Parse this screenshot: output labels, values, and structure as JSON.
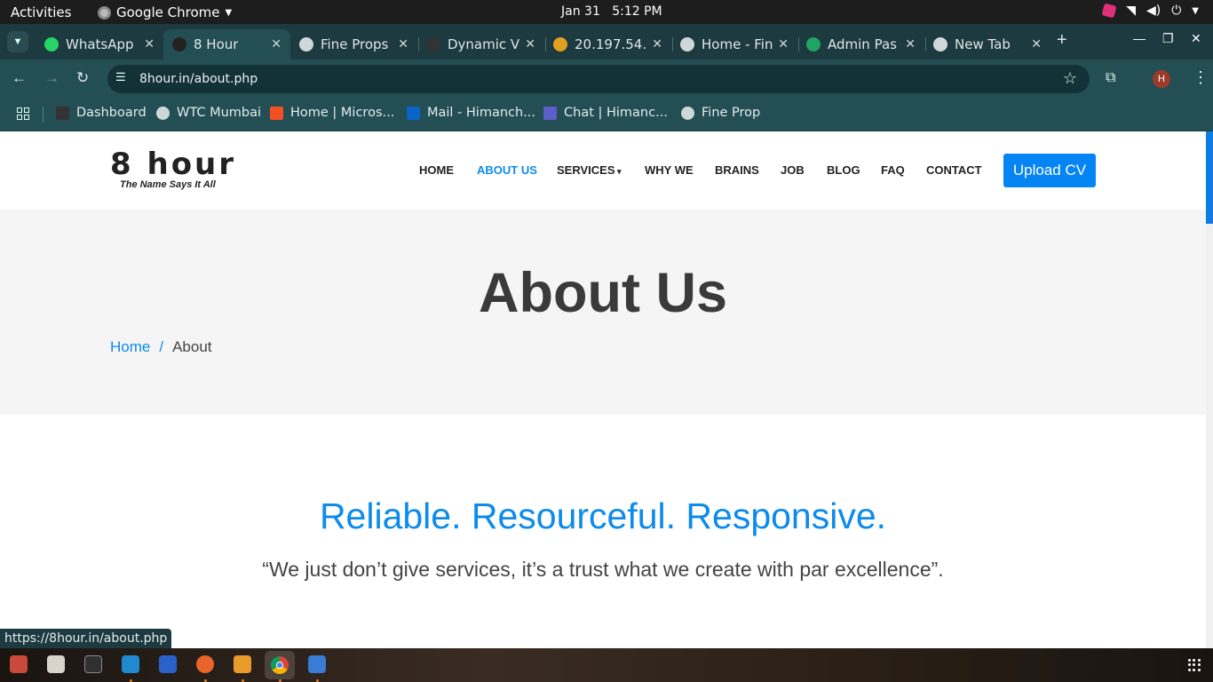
{
  "topbar": {
    "activities": "Activities",
    "app_name": "Google Chrome",
    "date": "Jan 31",
    "time": "5:12 PM"
  },
  "tabs": [
    {
      "title": "WhatsApp",
      "icon": "whatsapp-icon",
      "color": "#25d366"
    },
    {
      "title": "8 Hour",
      "icon": "8hour-icon",
      "color": "#222222",
      "active": true
    },
    {
      "title": "Fine Props",
      "icon": "globe-icon",
      "color": "#cfd8d8"
    },
    {
      "title": "Dynamic V",
      "icon": "dv-icon",
      "color": "#333333"
    },
    {
      "title": "20.197.54.",
      "icon": "triangle-icon",
      "color": "#e0a020"
    },
    {
      "title": "Home - Fin",
      "icon": "globe-icon",
      "color": "#cfd8d8"
    },
    {
      "title": "Admin Pas",
      "icon": "sheets-icon",
      "color": "#1fa463"
    },
    {
      "title": "New Tab",
      "icon": "chrome-icon",
      "color": "#cfd8d8"
    }
  ],
  "toolbar": {
    "url": "8hour.in/about.php",
    "avatar_letter": "H"
  },
  "bookmarks": [
    {
      "label": "Dashboard",
      "icon": "dv-icon",
      "color": "#333333"
    },
    {
      "label": "WTC Mumbai",
      "icon": "globe-icon",
      "color": "#cfd8d8"
    },
    {
      "label": "Home | Micros...",
      "icon": "microsoft-icon",
      "color": "#f25022"
    },
    {
      "label": "Mail - Himanch...",
      "icon": "outlook-icon",
      "color": "#0a64c8"
    },
    {
      "label": "Chat | Himanc...",
      "icon": "teams-icon",
      "color": "#5b5fc7"
    },
    {
      "label": "Fine Prop",
      "icon": "globe-icon",
      "color": "#cfd8d8"
    }
  ],
  "site": {
    "logo_text": "8 hour",
    "logo_tagline": "The Name Says It All",
    "nav": [
      {
        "label": "HOME"
      },
      {
        "label": "ABOUT US",
        "active": true
      },
      {
        "label": "SERVICES"
      },
      {
        "label": "WHY WE"
      },
      {
        "label": "BRAINS"
      },
      {
        "label": "JOB"
      },
      {
        "label": "BLOG"
      },
      {
        "label": "FAQ"
      },
      {
        "label": "CONTACT"
      }
    ],
    "upload_cv": "Upload CV",
    "page_title": "About Us",
    "breadcrumb_home": "Home",
    "breadcrumb_sep": "/",
    "breadcrumb_current": "About",
    "tagline": "Reliable. Resourceful. Responsive.",
    "quote": "“We just don’t give services, it’s a trust what we create with par excellence”.",
    "accent_color": "#0d8bec",
    "button_color": "#0585f4"
  },
  "status_url": "https://8hour.in/about.php"
}
